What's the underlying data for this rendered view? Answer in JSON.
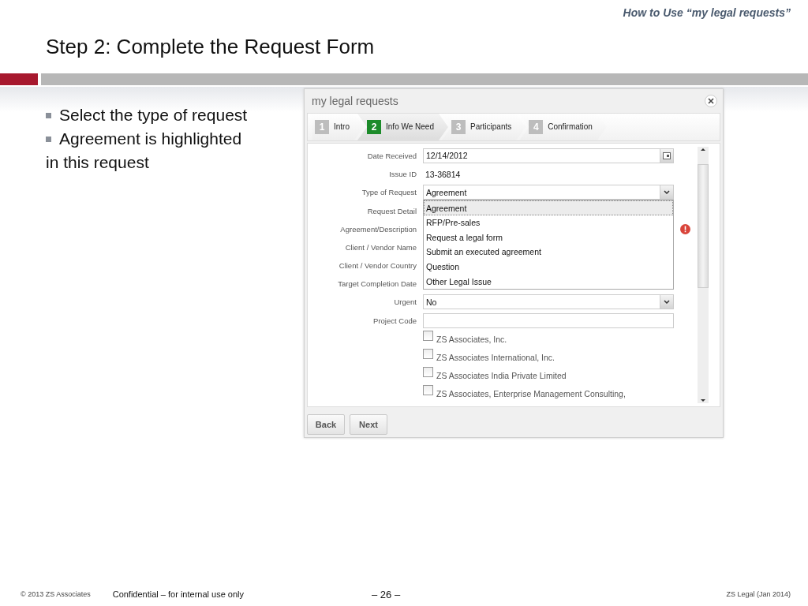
{
  "header": {
    "section": "How to Use “my legal requests”",
    "title": "Step 2: Complete the Request Form"
  },
  "bullets": [
    {
      "kind": "bullet",
      "text": "Select the type of request"
    },
    {
      "kind": "bullet",
      "text": "Agreement is highlighted"
    },
    {
      "kind": "plain",
      "text": "in this request"
    }
  ],
  "dialog": {
    "title": "my legal requests",
    "steps": [
      {
        "number": "1",
        "label": "Intro",
        "selected": false
      },
      {
        "number": "2",
        "label": "Info We Need",
        "selected": true
      },
      {
        "number": "3",
        "label": "Participants",
        "selected": false
      },
      {
        "number": "4",
        "label": "Confirmation",
        "selected": false
      }
    ],
    "fields": [
      {
        "label": "Date Received",
        "kind": "date",
        "value": "12/14/2012"
      },
      {
        "label": "Issue ID",
        "kind": "static",
        "value": "13-36814"
      },
      {
        "label": "Type of Request",
        "kind": "select",
        "value": "Agreement",
        "open": true,
        "options": [
          {
            "label": "Agreement",
            "selected": true
          },
          {
            "label": "RFP/Pre-sales",
            "selected": false
          },
          {
            "label": "Request a legal form",
            "selected": false
          },
          {
            "label": "Submit an executed agreement",
            "selected": false
          },
          {
            "label": "Question",
            "selected": false
          },
          {
            "label": "Other Legal Issue",
            "selected": false
          }
        ]
      },
      {
        "label": "Request Detail",
        "kind": "covered"
      },
      {
        "label": "Agreement/Description",
        "kind": "covered",
        "error": true
      },
      {
        "label": "Client / Vendor Name",
        "kind": "covered"
      },
      {
        "label": "Client / Vendor Country",
        "kind": "covered"
      },
      {
        "label": "Target Completion Date",
        "kind": "covered"
      },
      {
        "label": "Urgent",
        "kind": "select",
        "value": "No"
      },
      {
        "label": "Project Code",
        "kind": "text"
      }
    ],
    "companies": [
      {
        "label": "ZS Associates, Inc.",
        "checked": false
      },
      {
        "label": "ZS Associates International, Inc.",
        "checked": false
      },
      {
        "label": "ZS Associates India Private Limited",
        "checked": false
      },
      {
        "label": "ZS Associates, Enterprise Management Consulting,",
        "checked": false
      }
    ],
    "buttons": [
      "Back",
      "Next"
    ]
  },
  "footer": {
    "copyright": "© 2013 ZS Associates",
    "confidential": "Confidential – for internal use only",
    "page": "– 26 –",
    "version": "ZS Legal (Jan 2014)"
  }
}
